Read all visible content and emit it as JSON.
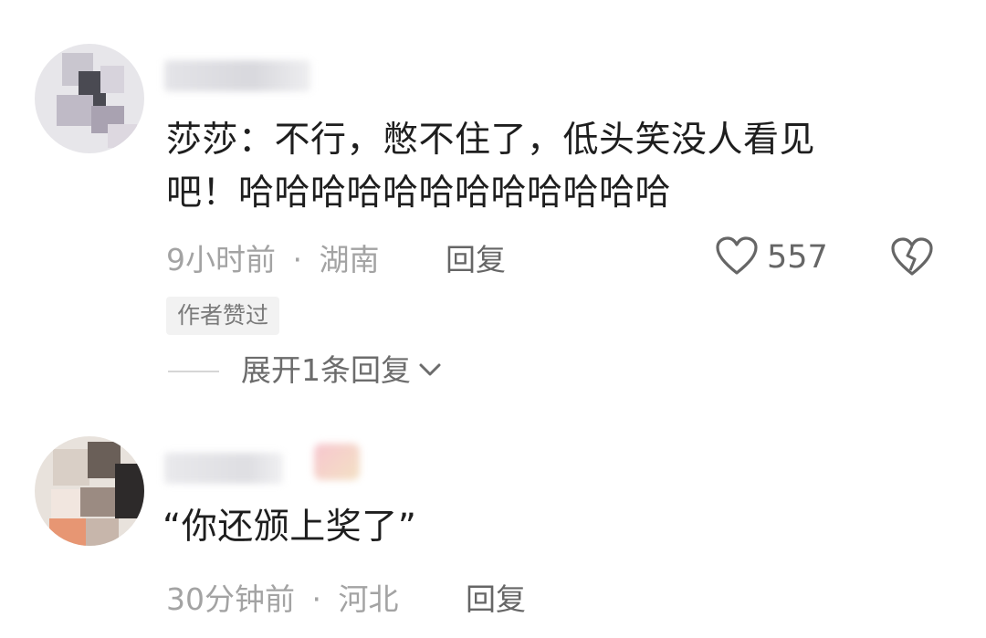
{
  "comments": [
    {
      "text_line1": "莎莎：不行，憋不住了，低头笑没人看见",
      "text_line2": "吧！哈哈哈哈哈哈哈哈哈哈哈哈",
      "time": "9小时前",
      "sep": "·",
      "location": "湖南",
      "reply_label": "回复",
      "likes": "557",
      "badge": "作者赞过",
      "expand_label": "展开1条回复"
    },
    {
      "text": "“你还颁上奖了”",
      "time": "30分钟前",
      "sep": "·",
      "location": "河北",
      "reply_label": "回复"
    }
  ],
  "icons": {
    "like": "heart-outline-icon",
    "dislike": "broken-heart-icon",
    "expand": "chevron-down-icon"
  }
}
